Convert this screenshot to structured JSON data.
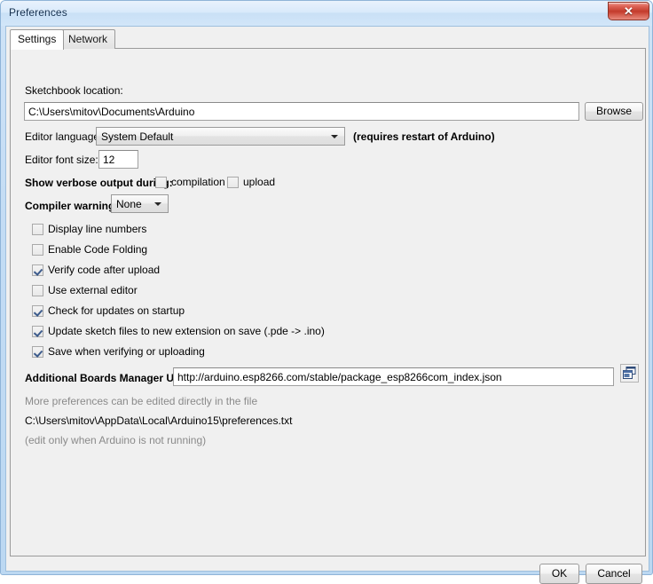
{
  "window": {
    "title": "Preferences",
    "close_label": "✕"
  },
  "tabs": [
    {
      "label": "Settings",
      "active": true
    },
    {
      "label": "Network",
      "active": false
    }
  ],
  "settings": {
    "sketchbook_label": "Sketchbook location:",
    "sketchbook_value": "C:\\Users\\mitov\\Documents\\Arduino",
    "browse_label": "Browse",
    "editor_language_label": "Editor language:",
    "editor_language_value": "System Default",
    "editor_language_note": "(requires restart of Arduino)",
    "editor_font_size_label": "Editor font size:",
    "editor_font_size_value": "12",
    "verbose_label": "Show verbose output during:",
    "verbose_compilation_label": "compilation",
    "verbose_upload_label": "upload",
    "compiler_warnings_label": "Compiler warnings:",
    "compiler_warnings_value": "None",
    "checkboxes": [
      {
        "label": "Display line numbers",
        "checked": false
      },
      {
        "label": "Enable Code Folding",
        "checked": false
      },
      {
        "label": "Verify code after upload",
        "checked": true
      },
      {
        "label": "Use external editor",
        "checked": false
      },
      {
        "label": "Check for updates on startup",
        "checked": true
      },
      {
        "label": "Update sketch files to new extension on save (.pde -> .ino)",
        "checked": true
      },
      {
        "label": "Save when verifying or uploading",
        "checked": true
      }
    ],
    "boards_urls_label": "Additional Boards Manager URLs:",
    "boards_urls_value": "http://arduino.esp8266.com/stable/package_esp8266com_index.json",
    "more_prefs_note": "More preferences can be edited directly in the file",
    "prefs_file_path": "C:\\Users\\mitov\\AppData\\Local\\Arduino15\\preferences.txt",
    "edit_warning": "(edit only when Arduino is not running)"
  },
  "footer": {
    "ok_label": "OK",
    "cancel_label": "Cancel"
  },
  "colors": {
    "window_frame": "#c3dcf4",
    "panel_bg": "#f0f0f0",
    "close_red": "#c33b2c",
    "check_blue": "#3c5b8c",
    "dim_text": "#8a8a8a"
  }
}
